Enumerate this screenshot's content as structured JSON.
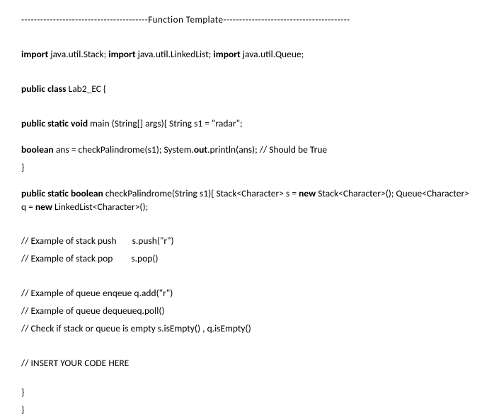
{
  "header": "----------------------------------------Function Template----------------------------------------",
  "import_line": {
    "kw1": "import",
    "v1": " java.util.Stack; ",
    "kw2": "import",
    "v2": " java.util.LinkedList; ",
    "kw3": "import",
    "v3": " java.util.Queue;"
  },
  "class_decl": {
    "kw": "public class",
    "name": " Lab2_EC {"
  },
  "main_line": {
    "kw": "public static void",
    "rest": " main (String[] args){ String s1 = \"radar\";"
  },
  "bool_line": {
    "kw": "boolean",
    "mid": " ans = checkPalindrome(s1); System.",
    "out_kw": "out",
    "rest": ".println(ans); // Should be True"
  },
  "brace1": "}",
  "method_line": {
    "kw": "public static boolean",
    "mid": " checkPalindrome(String s1){ Stack<Character> s = ",
    "new1": "new",
    "mid2": " Stack<Character>(); Queue<Character> q = ",
    "new2": "new",
    "rest": " LinkedList<Character>();"
  },
  "ex_push": {
    "label": "// Example of stack push",
    "code": "s.push(\"r\")"
  },
  "ex_pop": {
    "label": "// Example of stack pop",
    "code": "s.pop()"
  },
  "ex_enqueue": "// Example of queue enqeue  q.add(\"r\")",
  "ex_dequeue": "// Example of queue dequeueq.poll()",
  "ex_empty": "// Check if stack or queue is empty  s.isEmpty() ,  q.isEmpty()",
  "insert_comment": "// INSERT YOUR CODE HERE",
  "brace2": "}",
  "brace3": "}"
}
